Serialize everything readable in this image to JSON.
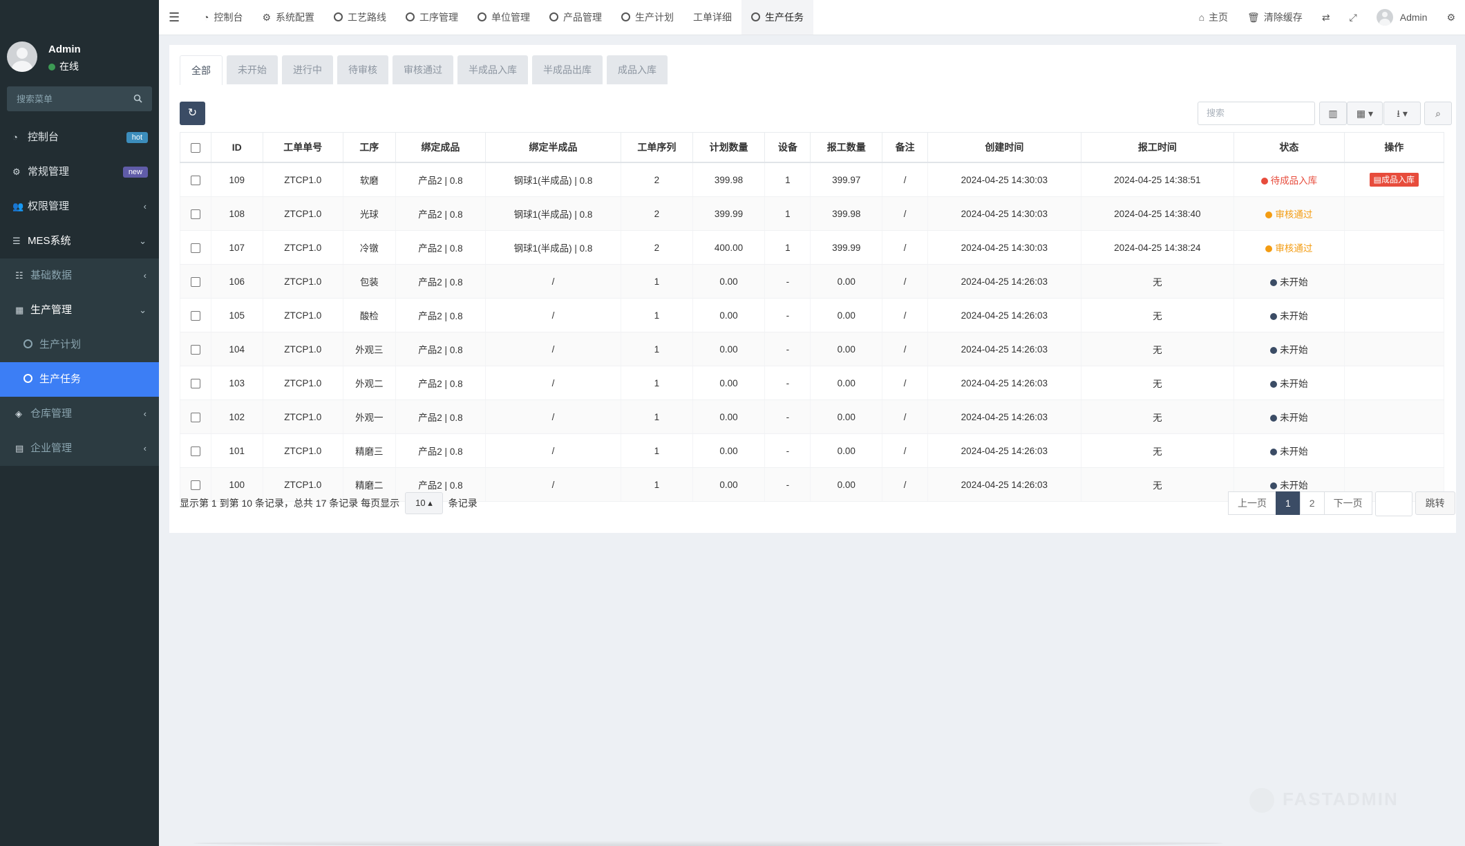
{
  "sidebar": {
    "user": {
      "name": "Admin",
      "status": "在线"
    },
    "search_placeholder": "搜索菜单",
    "items": [
      {
        "label": "控制台",
        "badge": "hot"
      },
      {
        "label": "常规管理",
        "badge": "new"
      },
      {
        "label": "权限管理"
      },
      {
        "label": "MES系统"
      }
    ],
    "mes": {
      "basic": "基础数据",
      "production": "生产管理",
      "plan": "生产计划",
      "task": "生产任务",
      "warehouse": "仓库管理",
      "enterprise": "企业管理"
    }
  },
  "topbar": {
    "tabs": [
      "控制台",
      "系统配置",
      "工艺路线",
      "工序管理",
      "单位管理",
      "产品管理",
      "生产计划",
      "工单详细",
      "生产任务"
    ],
    "home": "主页",
    "clear_cache": "清除缓存",
    "user": "Admin"
  },
  "filter_tabs": [
    "全部",
    "未开始",
    "进行中",
    "待审核",
    "审核通过",
    "半成品入库",
    "半成品出库",
    "成品入库"
  ],
  "search_placeholder": "搜索",
  "table": {
    "headers": [
      "ID",
      "工单单号",
      "工序",
      "绑定成品",
      "绑定半成品",
      "工单序列",
      "计划数量",
      "设备",
      "报工数量",
      "备注",
      "创建时间",
      "报工时间",
      "状态",
      "操作"
    ],
    "rows": [
      [
        "109",
        "ZTCP1.0",
        "软磨",
        "产品2 | 0.8",
        "钢球1(半成品) | 0.8",
        "2",
        "399.98",
        "1",
        "399.97",
        "/",
        "2024-04-25 14:30:03",
        "2024-04-25 14:38:51",
        "待成品入库",
        "成品入库"
      ],
      [
        "108",
        "ZTCP1.0",
        "光球",
        "产品2 | 0.8",
        "钢球1(半成品) | 0.8",
        "2",
        "399.99",
        "1",
        "399.98",
        "/",
        "2024-04-25 14:30:03",
        "2024-04-25 14:38:40",
        "审核通过",
        ""
      ],
      [
        "107",
        "ZTCP1.0",
        "冷镦",
        "产品2 | 0.8",
        "钢球1(半成品) | 0.8",
        "2",
        "400.00",
        "1",
        "399.99",
        "/",
        "2024-04-25 14:30:03",
        "2024-04-25 14:38:24",
        "审核通过",
        ""
      ],
      [
        "106",
        "ZTCP1.0",
        "包装",
        "产品2 | 0.8",
        "/",
        "1",
        "0.00",
        "-",
        "0.00",
        "/",
        "2024-04-25 14:26:03",
        "无",
        "未开始",
        ""
      ],
      [
        "105",
        "ZTCP1.0",
        "酸检",
        "产品2 | 0.8",
        "/",
        "1",
        "0.00",
        "-",
        "0.00",
        "/",
        "2024-04-25 14:26:03",
        "无",
        "未开始",
        ""
      ],
      [
        "104",
        "ZTCP1.0",
        "外观三",
        "产品2 | 0.8",
        "/",
        "1",
        "0.00",
        "-",
        "0.00",
        "/",
        "2024-04-25 14:26:03",
        "无",
        "未开始",
        ""
      ],
      [
        "103",
        "ZTCP1.0",
        "外观二",
        "产品2 | 0.8",
        "/",
        "1",
        "0.00",
        "-",
        "0.00",
        "/",
        "2024-04-25 14:26:03",
        "无",
        "未开始",
        ""
      ],
      [
        "102",
        "ZTCP1.0",
        "外观一",
        "产品2 | 0.8",
        "/",
        "1",
        "0.00",
        "-",
        "0.00",
        "/",
        "2024-04-25 14:26:03",
        "无",
        "未开始",
        ""
      ],
      [
        "101",
        "ZTCP1.0",
        "精磨三",
        "产品2 | 0.8",
        "/",
        "1",
        "0.00",
        "-",
        "0.00",
        "/",
        "2024-04-25 14:26:03",
        "无",
        "未开始",
        ""
      ],
      [
        "100",
        "ZTCP1.0",
        "精磨二",
        "产品2 | 0.8",
        "/",
        "1",
        "0.00",
        "-",
        "0.00",
        "/",
        "2024-04-25 14:26:03",
        "无",
        "未开始",
        ""
      ]
    ],
    "status_colors": {
      "待成品入库": "#e74c3c",
      "审核通过": "#f39c12",
      "未开始": "#3b4c65"
    }
  },
  "pagination": {
    "summary": "显示第 1 到第 10 条记录，总共 17 条记录 每页显示",
    "page_size": "10",
    "suffix": "条记录",
    "prev": "上一页",
    "pages": [
      "1",
      "2"
    ],
    "next": "下一页",
    "go": "跳转"
  },
  "watermark": "FASTADMIN"
}
